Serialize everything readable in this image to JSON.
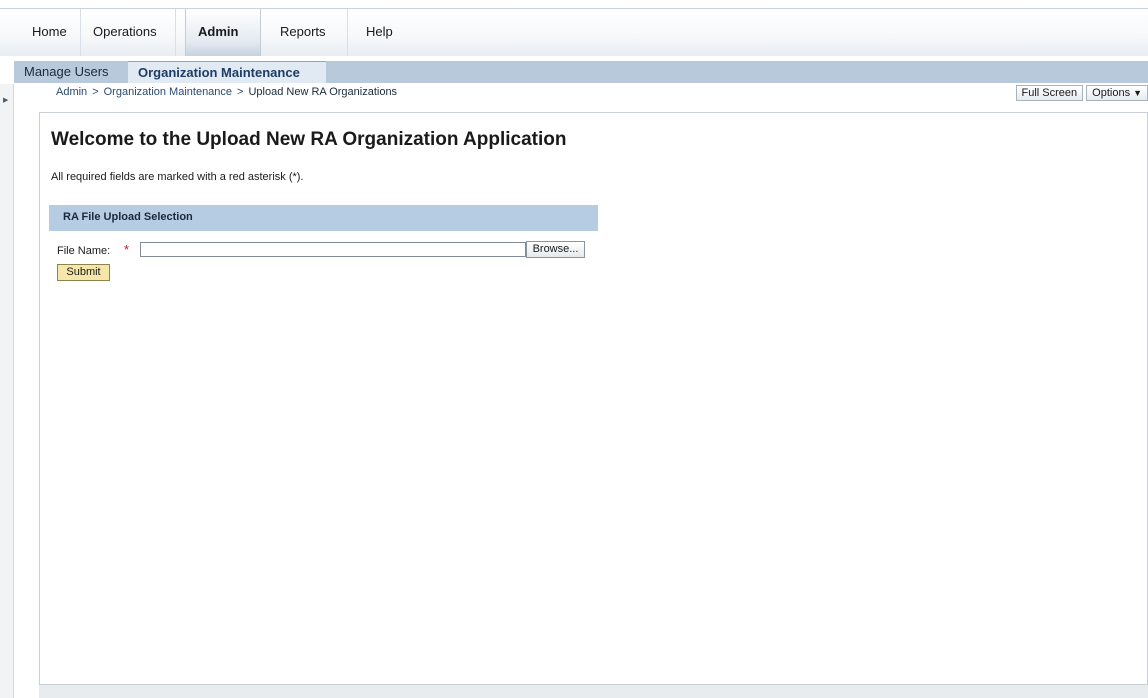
{
  "top_nav": {
    "tabs": [
      {
        "label": "Home"
      },
      {
        "label": "Operations"
      },
      {
        "label": "Admin"
      },
      {
        "label": "Reports"
      },
      {
        "label": "Help"
      }
    ],
    "active_tab": "Admin"
  },
  "sub_nav": {
    "tabs": [
      {
        "label": "Manage Users"
      },
      {
        "label": "Organization Maintenance"
      }
    ],
    "active_tab": "Organization Maintenance"
  },
  "breadcrumb": {
    "items": [
      "Admin",
      "Organization Maintenance",
      "Upload New RA Organizations"
    ],
    "separator": ">"
  },
  "toolbar": {
    "full_screen_label": "Full Screen",
    "options_label": "Options",
    "options_caret": "▼"
  },
  "left_strip": {
    "toggle_glyph": "▶"
  },
  "main": {
    "title": "Welcome to the Upload New RA Organization Application",
    "required_note": "All required fields are marked with a red asterisk (*).",
    "section_title": "RA File Upload Selection",
    "file_name_label": "File Name:",
    "required_marker": "*",
    "file_name_value": "",
    "browse_label": "Browse...",
    "submit_label": "Submit"
  },
  "colors": {
    "section_header_bg": "#b6cce2",
    "subnav_bg": "#b8c9dc",
    "required_red": "#c8102e",
    "submit_bg": "#f6e7a8"
  }
}
